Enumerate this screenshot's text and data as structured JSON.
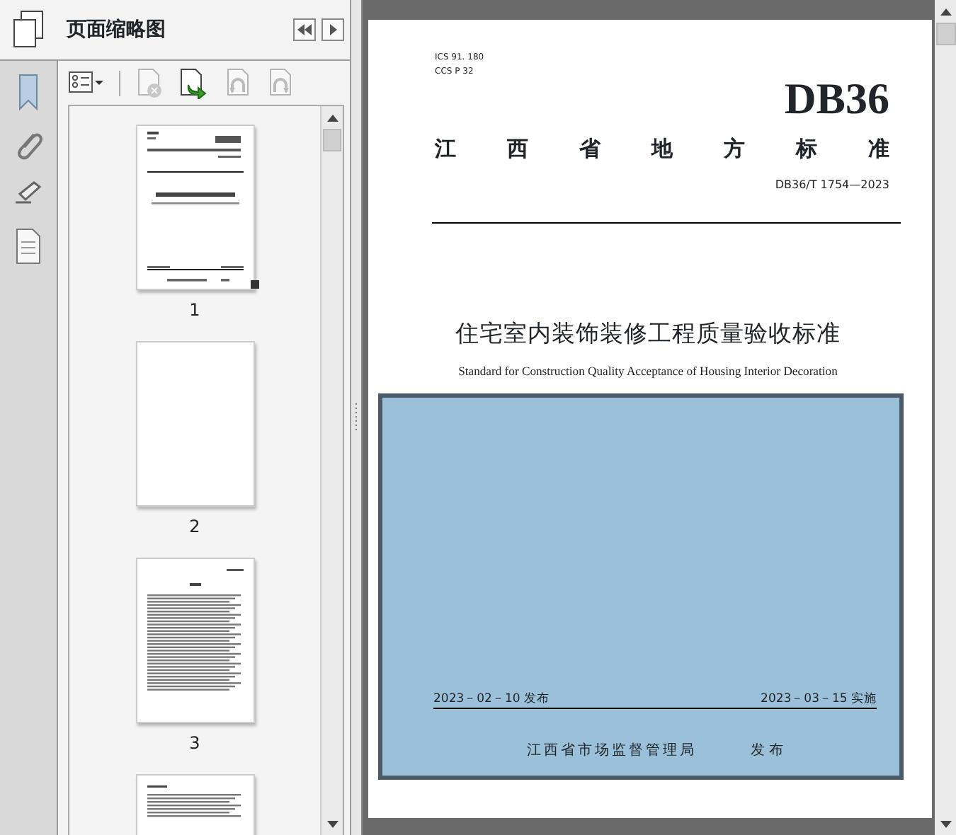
{
  "panel": {
    "title": "页面缩略图"
  },
  "toolbar": [
    {
      "kind": "options",
      "disabled": false
    },
    {
      "kind": "delete",
      "disabled": true
    },
    {
      "kind": "insert",
      "disabled": false
    },
    {
      "kind": "rotate-left",
      "disabled": true
    },
    {
      "kind": "rotate-right",
      "disabled": true
    }
  ],
  "thumbnails": [
    {
      "kind": "cover",
      "number": "1",
      "selected": true
    },
    {
      "kind": "blank",
      "number": "2",
      "selected": false
    },
    {
      "kind": "contents",
      "number": "3",
      "selected": false
    },
    {
      "kind": "contents-end",
      "selected": false
    }
  ],
  "document": {
    "ics": "ICS 91. 180",
    "ccs": "CCS  P 32",
    "code": "DB36",
    "category": "江西省地方标准",
    "standard_number": "DB36/T 1754—2023",
    "title": "住宅室内装饰装修工程质量验收标准",
    "english_title": "Standard for Construction Quality Acceptance of Housing Interior Decoration",
    "issue_date": "2023－02－10 发布",
    "effective_date": "2023－03－15 实施",
    "publisher": "江西省市场监督管理局",
    "publish_label": "发 布"
  }
}
